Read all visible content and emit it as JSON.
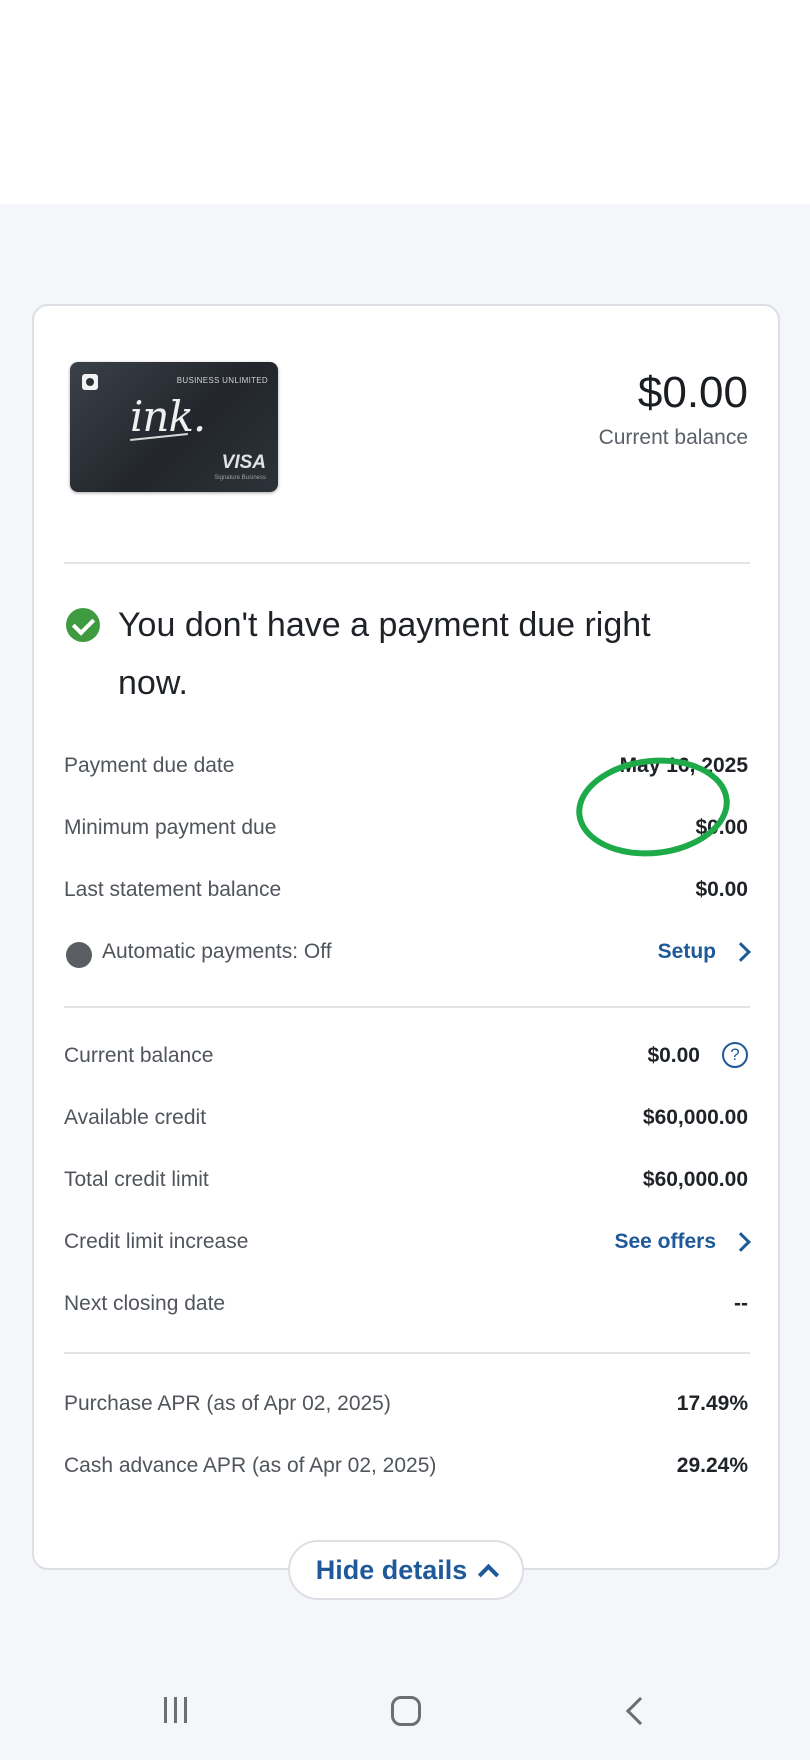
{
  "card_image": {
    "tier": "BUSINESS UNLIMITED",
    "script": "ink.",
    "network": "VISA",
    "network_sub": "Signature Business"
  },
  "balance": {
    "amount": "$0.00",
    "label": "Current balance"
  },
  "status": {
    "message": "You don't have a payment due right now."
  },
  "payment_section": [
    {
      "label": "Payment due date",
      "value": "May 16, 2025"
    },
    {
      "label": "Minimum payment due",
      "value": "$0.00"
    },
    {
      "label": "Last statement balance",
      "value": "$0.00"
    }
  ],
  "autopay": {
    "label": "Automatic payments: Off",
    "link": "Setup"
  },
  "credit_section": {
    "current_balance_label": "Current balance",
    "current_balance_value": "$0.00",
    "available_credit_label": "Available credit",
    "available_credit_value": "$60,000.00",
    "total_credit_limit_label": "Total credit limit",
    "total_credit_limit_value": "$60,000.00",
    "credit_limit_increase_label": "Credit limit increase",
    "credit_limit_increase_link": "See offers",
    "next_closing_label": "Next closing date",
    "next_closing_value": "--"
  },
  "apr_section": [
    {
      "label": "Purchase APR (as of Apr 02, 2025)",
      "value": "17.49%"
    },
    {
      "label": "Cash advance APR (as of Apr 02, 2025)",
      "value": "29.24%"
    }
  ],
  "hide_details": "Hide details",
  "help_icon_glyph": "?",
  "colors": {
    "accent": "#1e5a99",
    "success": "#3f9b3f",
    "highlight": "#1faa4a"
  }
}
